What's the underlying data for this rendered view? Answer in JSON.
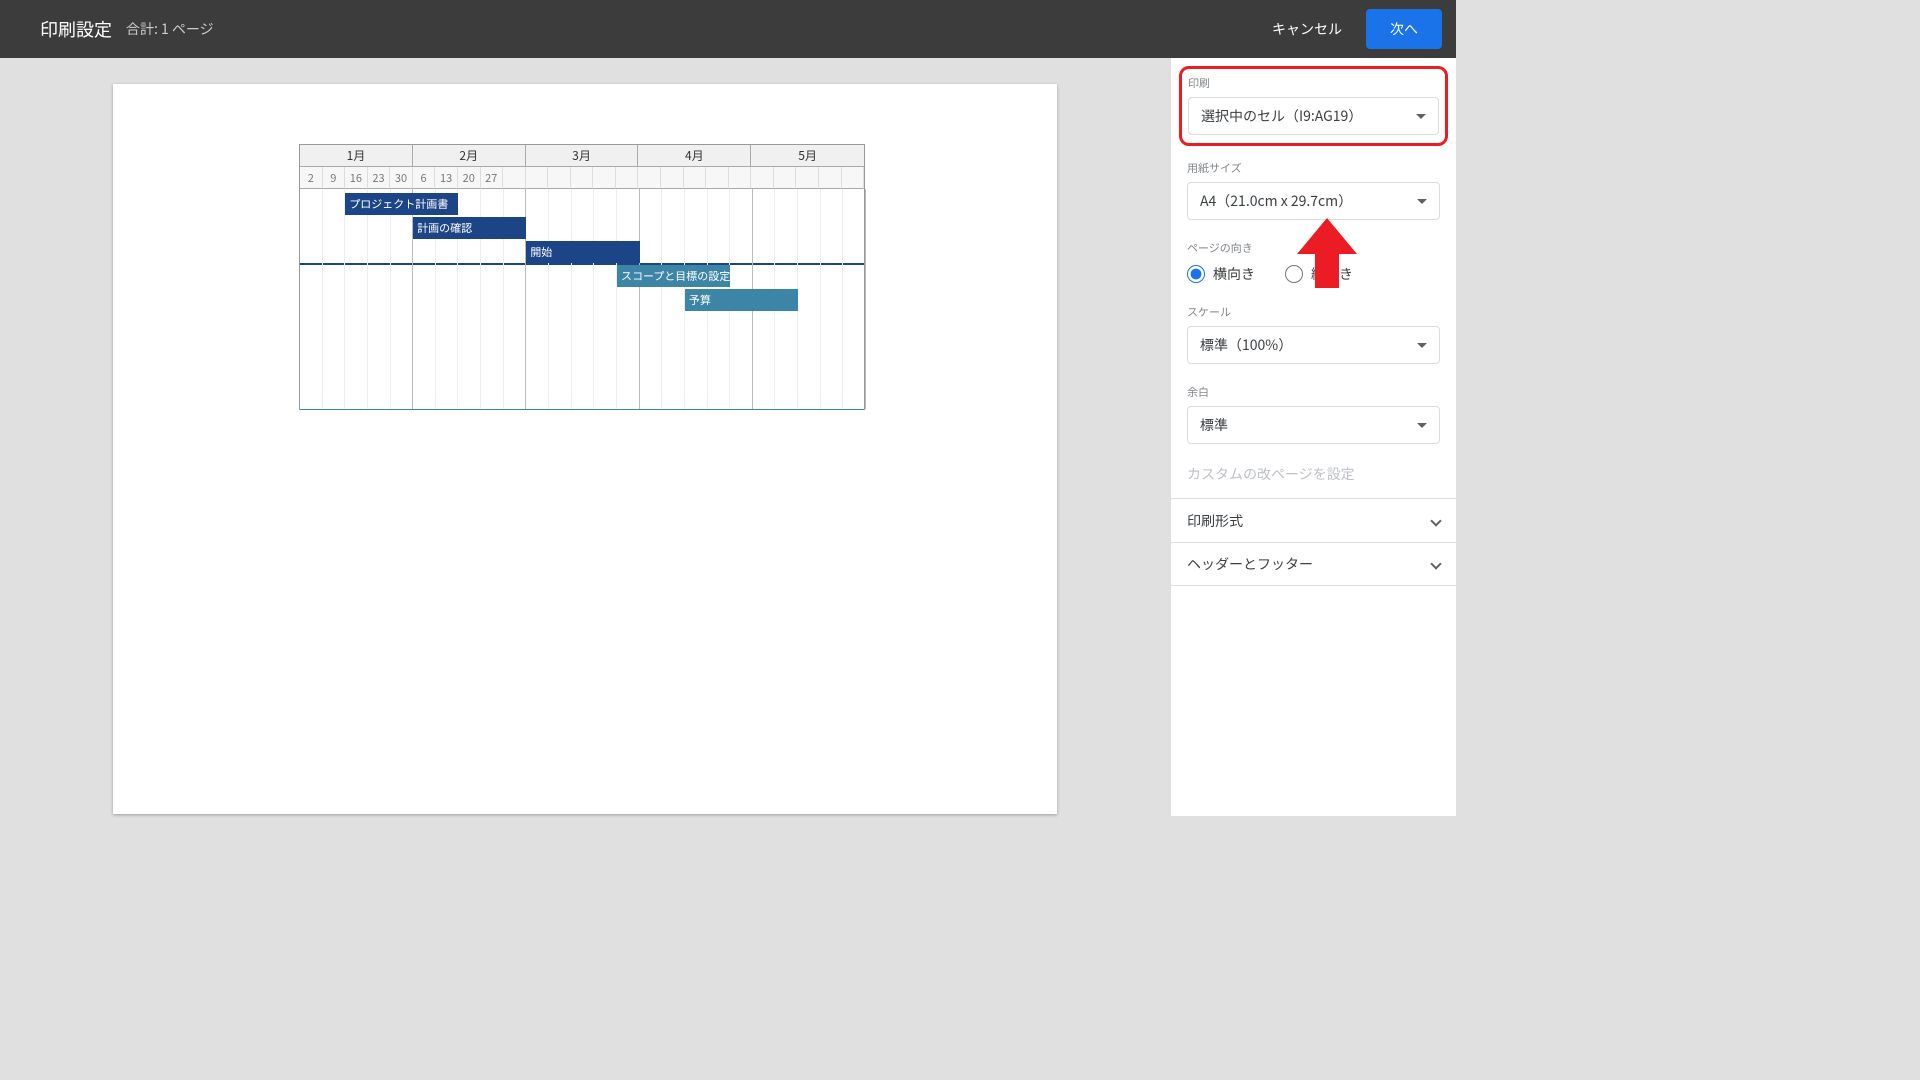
{
  "header": {
    "title": "印刷設定",
    "subtitle": "合計: 1 ページ",
    "cancel": "キャンセル",
    "next": "次へ"
  },
  "panel": {
    "print_label": "印刷",
    "print_value": "選択中のセル（I9:AG19）",
    "paper_label": "用紙サイズ",
    "paper_value": "A4（21.0cm x 29.7cm）",
    "orient_label": "ページの向き",
    "orient_land": "横向き",
    "orient_port": "縦向き",
    "scale_label": "スケール",
    "scale_value": "標準（100%）",
    "margin_label": "余白",
    "margin_value": "標準",
    "custom_breaks": "カスタムの改ページを設定",
    "format": "印刷形式",
    "headers": "ヘッダーとフッター"
  },
  "gantt": {
    "months": [
      "1月",
      "2月",
      "3月",
      "4月",
      "5月"
    ],
    "month_spans": [
      5,
      5,
      5,
      5,
      5
    ],
    "day_labels": [
      "2",
      "9",
      "16",
      "23",
      "30",
      "6",
      "13",
      "20",
      "27",
      "",
      "",
      "",
      "",
      "",
      "",
      "",
      "",
      "",
      "",
      "",
      "",
      "",
      "",
      "",
      ""
    ],
    "bars": [
      {
        "label": "プロジェクト計画書",
        "row": 0,
        "start": 2,
        "span": 5,
        "cls": "blue"
      },
      {
        "label": "計画の確認",
        "row": 1,
        "start": 5,
        "span": 5,
        "cls": "blue"
      },
      {
        "label": "開始",
        "row": 2,
        "start": 10,
        "span": 5,
        "cls": "blue"
      },
      {
        "label": "スコープと目標の設定",
        "row": 3,
        "start": 14,
        "span": 5,
        "cls": "teal"
      },
      {
        "label": "予算",
        "row": 4,
        "start": 17,
        "span": 5,
        "cls": "teal"
      }
    ]
  }
}
